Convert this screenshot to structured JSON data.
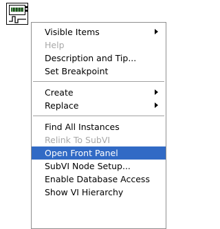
{
  "node_icon": {
    "name": "subvi-node-icon"
  },
  "menu": {
    "group1": [
      {
        "label": "Visible Items",
        "submenu": true,
        "disabled": false
      },
      {
        "label": "Help",
        "submenu": false,
        "disabled": true
      },
      {
        "label": "Description and Tip...",
        "submenu": false,
        "disabled": false
      },
      {
        "label": "Set Breakpoint",
        "submenu": false,
        "disabled": false
      }
    ],
    "group2": [
      {
        "label": "Create",
        "submenu": true,
        "disabled": false
      },
      {
        "label": "Replace",
        "submenu": true,
        "disabled": false
      }
    ],
    "group3": [
      {
        "label": "Find All Instances",
        "submenu": false,
        "disabled": false
      },
      {
        "label": "Relink To SubVI",
        "submenu": false,
        "disabled": true
      },
      {
        "label": "Open Front Panel",
        "submenu": false,
        "disabled": false,
        "highlighted": true
      },
      {
        "label": "SubVI Node Setup...",
        "submenu": false,
        "disabled": false
      },
      {
        "label": "Enable Database Access",
        "submenu": false,
        "disabled": false
      },
      {
        "label": "Show VI Hierarchy",
        "submenu": false,
        "disabled": false
      }
    ]
  },
  "colors": {
    "highlight": "#316ac5",
    "disabled_text": "#a8a8a8",
    "menu_border": "#8e8e8e"
  }
}
